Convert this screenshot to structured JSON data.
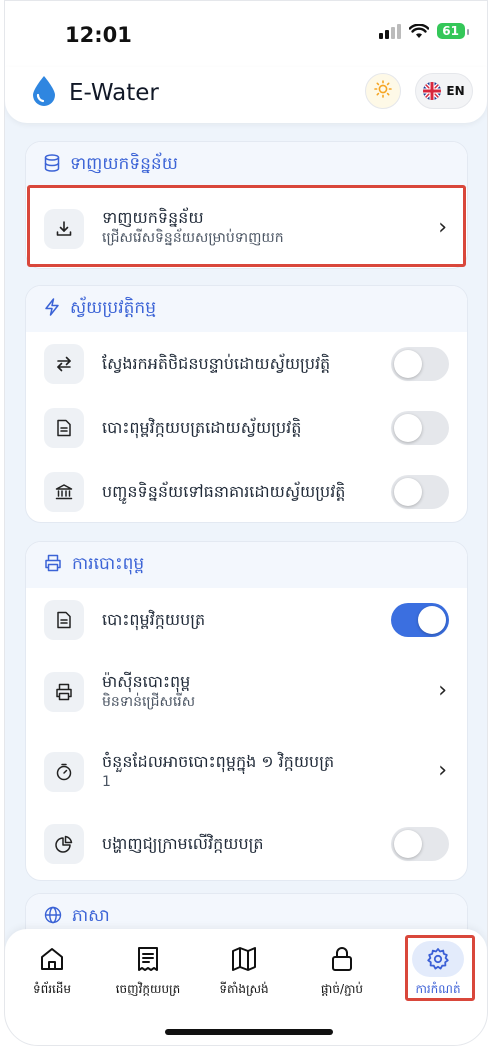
{
  "status_bar": {
    "time": "12:01",
    "battery": "61"
  },
  "header": {
    "app_title": "E-Water",
    "lang_label": "EN"
  },
  "sections": {
    "download": {
      "title": "ទាញយកទិន្នន័យ",
      "rows": [
        {
          "title": "ទាញយកទិន្នន័យ",
          "subtitle": "ជ្រើសរើសទិន្នន័យសម្រាប់ទាញយក"
        }
      ]
    },
    "automation": {
      "title": "ស្វ័យប្រវត្តិកម្ម",
      "rows": [
        {
          "title": "ស្វែងរកអតិថិជនបន្ទាប់ដោយស្វ័យប្រវត្តិ",
          "on": false
        },
        {
          "title": "បោះពុម្ពវិក្កយបត្រដោយស្វ័យប្រវត្តិ",
          "on": false
        },
        {
          "title": "បញ្ជូនទិន្នន័យទៅធនាគារដោយស្វ័យប្រវត្តិ",
          "on": false
        }
      ]
    },
    "printing": {
      "title": "ការបោះពុម្ព",
      "rows": [
        {
          "title": "បោះពុម្ពវិក្កយបត្រ",
          "on": true
        },
        {
          "title": "ម៉ាស៊ីនបោះពុម្ព",
          "subtitle": "មិនទាន់ជ្រើសរើស"
        },
        {
          "title": "ចំនួនដែលអាចបោះពុម្ពក្នុង ១ វិក្កយបត្រ",
          "subtitle": "1"
        },
        {
          "title": "បង្ហាញជ្យក្រាមលើវិក្កយបត្រ",
          "on": false
        }
      ]
    },
    "language": {
      "title": "ភាសា"
    }
  },
  "bottom_nav": [
    {
      "label": "ទំព័រដើម",
      "icon": "home-icon",
      "active": false
    },
    {
      "label": "ចេញវិក្កយបត្រ",
      "icon": "receipt-icon",
      "active": false
    },
    {
      "label": "ទីតាំងស្រង់",
      "icon": "map-icon",
      "active": false
    },
    {
      "label": "ផ្ដាច់/ភ្ជាប់",
      "icon": "lock-icon",
      "active": false
    },
    {
      "label": "ការកំណត់",
      "icon": "gear-icon",
      "active": true
    }
  ],
  "colors": {
    "accent": "#3b63d6",
    "toggle_on": "#3b6fe0",
    "highlight": "#d9473b",
    "background": "#eef4fb"
  }
}
